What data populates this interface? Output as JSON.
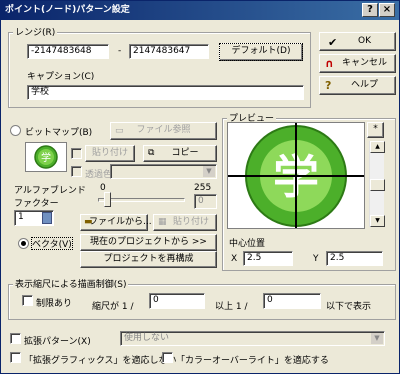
{
  "window": {
    "title": "ポイント(ノード)パターン設定",
    "help_btn": "?",
    "close_btn": "×"
  },
  "range": {
    "legend": "レンジ(R)",
    "min": "-2147483648",
    "dash": "-",
    "max": "2147483647",
    "default_label": "デフォルト(D)",
    "caption_label": "キャプション(C)",
    "caption_value": "学校"
  },
  "actions": {
    "ok": "OK",
    "cancel": "キャンセル",
    "help": "ヘルプ"
  },
  "bitmap": {
    "radio_label": "ビットマップ(B)",
    "file_ref": "ファイル参照",
    "paste": "貼り付け",
    "copy": "コピー",
    "transparent_label": "透過色"
  },
  "alpha": {
    "label": "アルファブレンド",
    "min": "0",
    "max": "255",
    "value": "0",
    "level": 0.1
  },
  "factor": {
    "label": "ファクター",
    "value": "1"
  },
  "vector": {
    "radio_label": "ベクタ(V)",
    "file_from": "ファイルから...",
    "paste": "貼り付け",
    "from_project": "現在のプロジェクトから >>",
    "reconstruct": "プロジェクトを再構成"
  },
  "preview": {
    "legend": "プレビュー",
    "star_btn": "*",
    "center_label": "中心位置",
    "x_label": "X",
    "x_value": "2.5",
    "y_label": "Y",
    "y_value": "2.5",
    "glyph": "学"
  },
  "scale": {
    "legend": "表示縮尺による描画制御(S)",
    "limit_label": "制限あり",
    "ratio_prefix": "縮尺が 1 /",
    "from_value": "0",
    "mid": "以上 1 /",
    "to_value": "0",
    "suffix": "以下で表示"
  },
  "ext": {
    "pattern_label": "拡張パターン(X)",
    "pattern_select": "使用しない",
    "no_ext_graphics": "「拡張グラフィックス」を適応しない",
    "color_overwrite": "「カラーオーバーライト」を適応する"
  },
  "colors": {
    "title_from": "#0a246a",
    "title_to": "#3a6ea5",
    "icon_green": "#4caf2a",
    "ok_check": "#000000"
  }
}
